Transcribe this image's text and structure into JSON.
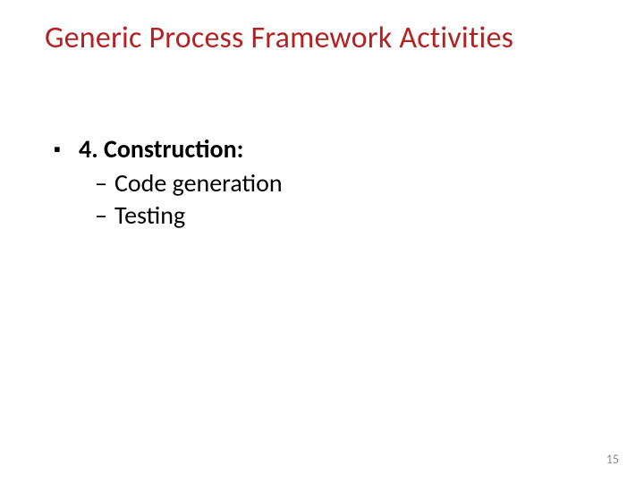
{
  "title": "Generic Process Framework Activities",
  "item": {
    "label": "4. Construction:",
    "sub": [
      "Code generation",
      "Testing"
    ]
  },
  "page_number": "15"
}
